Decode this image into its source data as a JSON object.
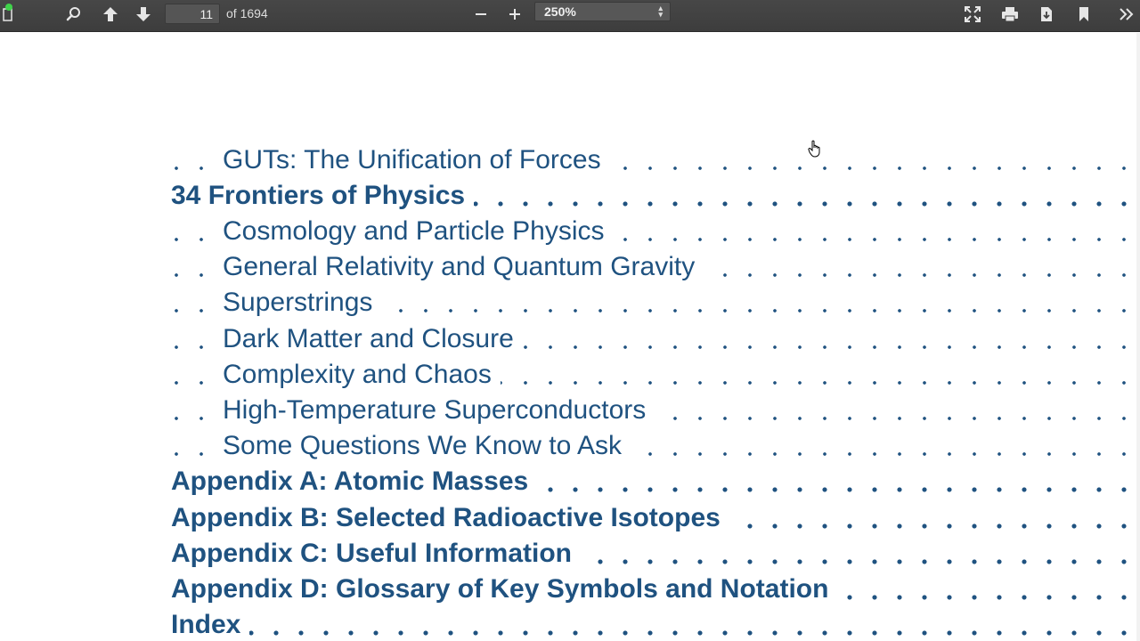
{
  "toolbar": {
    "page_number": "11",
    "page_count": "of 1694",
    "zoom": "250%",
    "icons": [
      "sidebar-toggle-icon",
      "search-icon",
      "previous-page-icon",
      "next-page-icon",
      "zoom-out-icon",
      "zoom-in-icon",
      "presentation-mode-icon",
      "print-icon",
      "download-icon",
      "bookmark-icon",
      "tools-icon"
    ]
  },
  "toc": {
    "entries": [
      {
        "title": "GUTs: The Unification of Forces",
        "level": 2
      },
      {
        "title": "34 Frontiers of Physics",
        "level": 1
      },
      {
        "title": "Cosmology and Particle Physics",
        "level": 2
      },
      {
        "title": "General Relativity and Quantum Gravity",
        "level": 2
      },
      {
        "title": "Superstrings",
        "level": 2
      },
      {
        "title": "Dark Matter and Closure",
        "level": 2
      },
      {
        "title": "Complexity and Chaos",
        "level": 2
      },
      {
        "title": "High-Temperature Superconductors",
        "level": 2
      },
      {
        "title": "Some Questions We Know to Ask",
        "level": 2
      },
      {
        "title": "Appendix A: Atomic Masses",
        "level": 1
      },
      {
        "title": "Appendix B: Selected Radioactive Isotopes",
        "level": 1
      },
      {
        "title": "Appendix C: Useful Information",
        "level": 1
      },
      {
        "title": "Appendix D: Glossary of Key Symbols and Notation",
        "level": 1
      },
      {
        "title": "Index",
        "level": 1
      }
    ]
  },
  "colors": {
    "toolbar_bg": "#404040",
    "toc_text": "#1f5280"
  }
}
